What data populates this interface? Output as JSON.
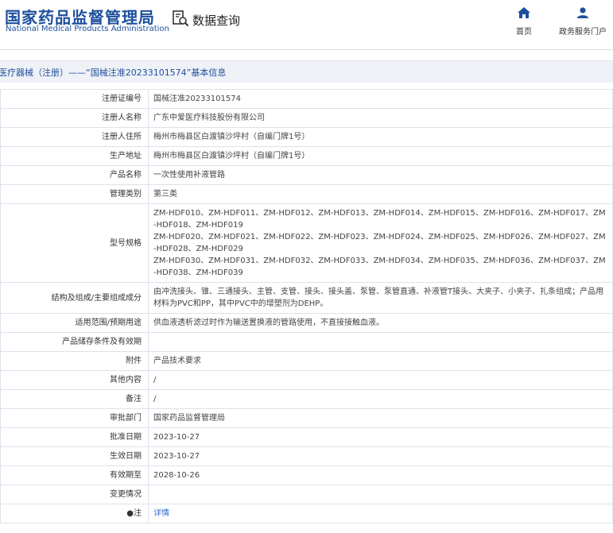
{
  "header": {
    "logo_cn": "国家药品监督管理局",
    "logo_en": "National Medical Products Administration",
    "search_title": "数据查询",
    "nav": [
      {
        "label": "首页",
        "icon": "home-icon"
      },
      {
        "label": "政务服务门户",
        "icon": "user-icon"
      }
    ]
  },
  "breadcrumb": "医疗器械（注册）——“国械注准20233101574”基本信息",
  "rows": [
    {
      "label": "注册证编号",
      "value": "国械注准20233101574"
    },
    {
      "label": "注册人名称",
      "value": "广东中爱医疗科技股份有限公司"
    },
    {
      "label": "注册人住所",
      "value": "梅州市梅县区白渡镇沙坪村（自编门牌1号）"
    },
    {
      "label": "生产地址",
      "value": "梅州市梅县区白渡镇沙坪村（自编门牌1号）"
    },
    {
      "label": "产品名称",
      "value": "一次性使用补液管路"
    },
    {
      "label": "管理类别",
      "value": "第三类"
    },
    {
      "label": "型号规格",
      "lines": [
        "ZM-HDF010、ZM-HDF011、ZM-HDF012、ZM-HDF013、ZM-HDF014、ZM-HDF015、ZM-HDF016、ZM-HDF017、ZM-HDF018、ZM-HDF019",
        "ZM-HDF020、ZM-HDF021、ZM-HDF022、ZM-HDF023、ZM-HDF024、ZM-HDF025、ZM-HDF026、ZM-HDF027、ZM-HDF028、ZM-HDF029",
        "ZM-HDF030、ZM-HDF031、ZM-HDF032、ZM-HDF033、ZM-HDF034、ZM-HDF035、ZM-HDF036、ZM-HDF037、ZM-HDF038、ZM-HDF039"
      ]
    },
    {
      "label": "结构及组成/主要组成成分",
      "value": "由冲洗接头、锥、三通接头、主管、支管、接头、接头盖、泵管、泵管直通、补液管T接头、大夹子、小夹子、扎条组成；产品用材料为PVC和PP，其中PVC中的增塑剂为DEHP。"
    },
    {
      "label": "适用范围/预期用途",
      "value": "供血液透析滤过时作为输送置换液的管路使用，不直接接触血液。"
    },
    {
      "label": "产品储存条件及有效期",
      "value": ""
    },
    {
      "label": "附件",
      "value": "产品技术要求"
    },
    {
      "label": "其他内容",
      "value": "/"
    },
    {
      "label": "备注",
      "value": "/"
    },
    {
      "label": "审批部门",
      "value": "国家药品监督管理局"
    },
    {
      "label": "批准日期",
      "value": "2023-10-27"
    },
    {
      "label": "生效日期",
      "value": "2023-10-27"
    },
    {
      "label": "有效期至",
      "value": "2028-10-26"
    },
    {
      "label": "变更情况",
      "value": ""
    },
    {
      "label": "●注",
      "value": "详情",
      "link": true
    }
  ],
  "colors": {
    "brand": "#1d4f9c",
    "link": "#2a6bd1",
    "border": "#dde2ea",
    "breadcrumb_bg": "#eef1f6"
  }
}
